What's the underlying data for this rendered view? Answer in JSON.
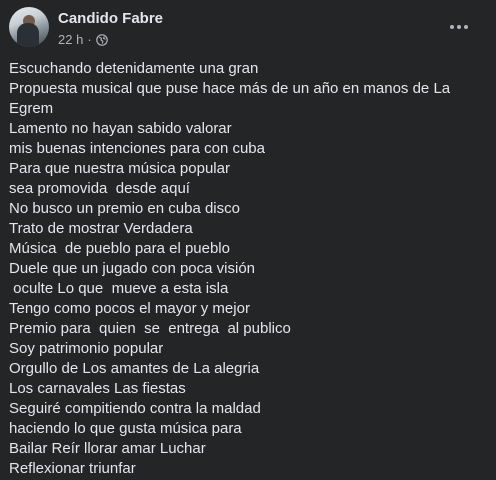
{
  "post": {
    "author": "Candido Fabre",
    "time": "22 h",
    "separator": "·",
    "privacy_icon": "globe-icon",
    "more_icon": "more-horizontal-icon",
    "lines": [
      "Escuchando detenidamente una gran",
      "Propuesta musical que puse hace más de un año en manos de La",
      "Egrem",
      "Lamento no hayan sabido valorar",
      "mis buenas intenciones para con cuba",
      "Para que nuestra música popular",
      "sea promovida  desde aquí",
      "No busco un premio en cuba disco",
      "Trato de mostrar Verdadera",
      "Música  de pueblo para el pueblo",
      "Duele que un jugado con poca visión",
      " oculte Lo que  mueve a esta isla",
      "Tengo como pocos el mayor y mejor",
      "Premio para  quien  se  entrega  al publico",
      "Soy patrimonio popular",
      "Orgullo de Los amantes de La alegria",
      "Los carnavales Las fiestas",
      "Seguiré compitiendo contra la maldad",
      "haciendo lo que gusta música para",
      "Bailar Reír llorar amar Luchar",
      "Reflexionar triunfar"
    ]
  }
}
